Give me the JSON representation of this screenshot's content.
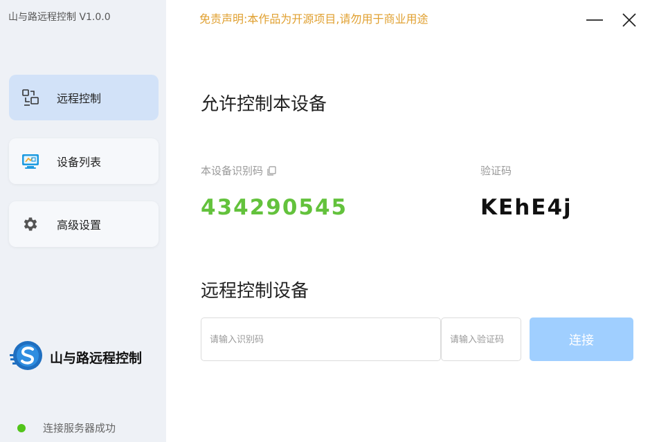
{
  "app": {
    "title": "山与路远程控制 V1.0.0",
    "brand_name": "山与路远程控制"
  },
  "sidebar": {
    "items": [
      {
        "label": "远程控制",
        "icon": "remote-control-icon",
        "active": true
      },
      {
        "label": "设备列表",
        "icon": "monitor-icon",
        "active": false
      },
      {
        "label": "高级设置",
        "icon": "gear-icon",
        "active": false
      }
    ]
  },
  "status": {
    "text": "连接服务器成功",
    "color": "#52c41a"
  },
  "header": {
    "disclaimer": "免责声明:本作品为开源项目,请勿用于商业用途"
  },
  "allow": {
    "title": "允许控制本设备",
    "device_id_label": "本设备识别码",
    "device_id": "434290545",
    "verify_label": "验证码",
    "verify_code": "KEhE4j"
  },
  "remote": {
    "title": "远程控制设备",
    "id_placeholder": "请输入识别码",
    "code_placeholder": "请输入验证码",
    "connect_label": "连接"
  },
  "colors": {
    "accent": "#a0cfff",
    "device_id": "#63c23c",
    "disclaimer": "#e0a030",
    "sidebar_bg": "#eef1f6",
    "active_item": "#d2e2f8"
  }
}
